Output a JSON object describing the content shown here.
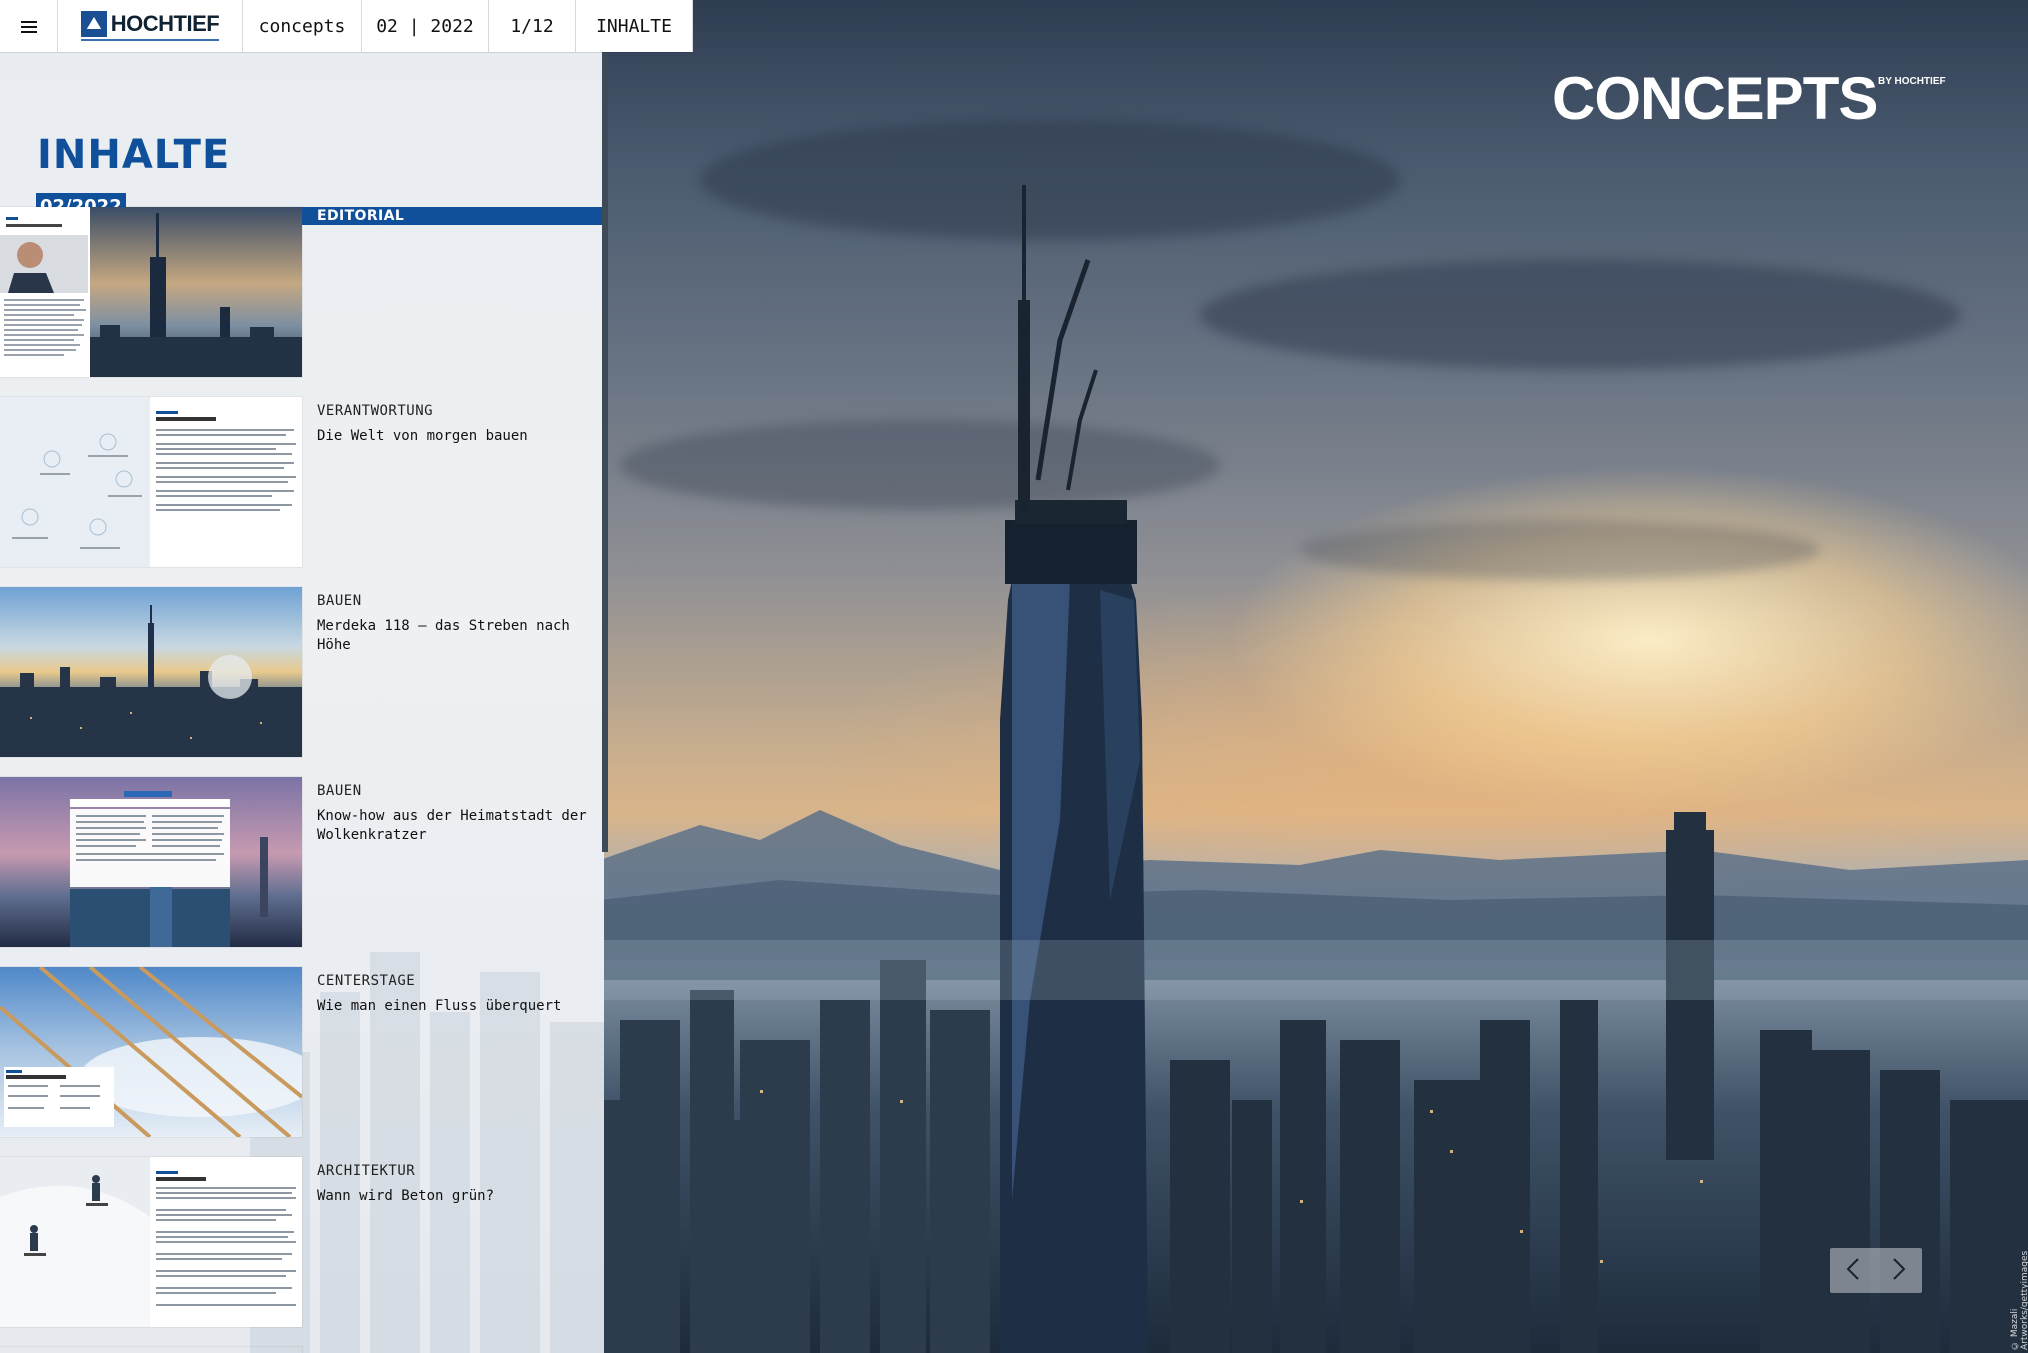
{
  "nav": {
    "menu_icon": "hamburger-icon",
    "logo_text": "HOCHTIEF",
    "items": [
      "concepts",
      "02 | 2022",
      "1/12",
      "INHALTE"
    ]
  },
  "panel": {
    "heading": "INHALTE",
    "issue": "02/2022",
    "entries": [
      {
        "category": "EDITORIAL",
        "title": ""
      },
      {
        "category": "VERANTWORTUNG",
        "title": "Die Welt von morgen bauen"
      },
      {
        "category": "BAUEN",
        "title": "Merdeka 118 – das Streben nach Höhe"
      },
      {
        "category": "BAUEN",
        "title": "Know-how aus der Heimatstadt der Wolkenkratzer"
      },
      {
        "category": "CENTERSTAGE",
        "title": "Wie man einen Fluss überquert"
      },
      {
        "category": "ARCHITEKTUR",
        "title": "Wann wird Beton grün?"
      }
    ]
  },
  "brand": {
    "name": "CONCEPTS",
    "sub": "BY HOCHTIEF"
  },
  "pager": {
    "prev_icon": "chevron-left-icon",
    "next_icon": "chevron-right-icon"
  },
  "credit": "© Mazali Artworks/gettyimages",
  "colors": {
    "accent": "#10509a",
    "panel_bg": "#eceff2"
  }
}
